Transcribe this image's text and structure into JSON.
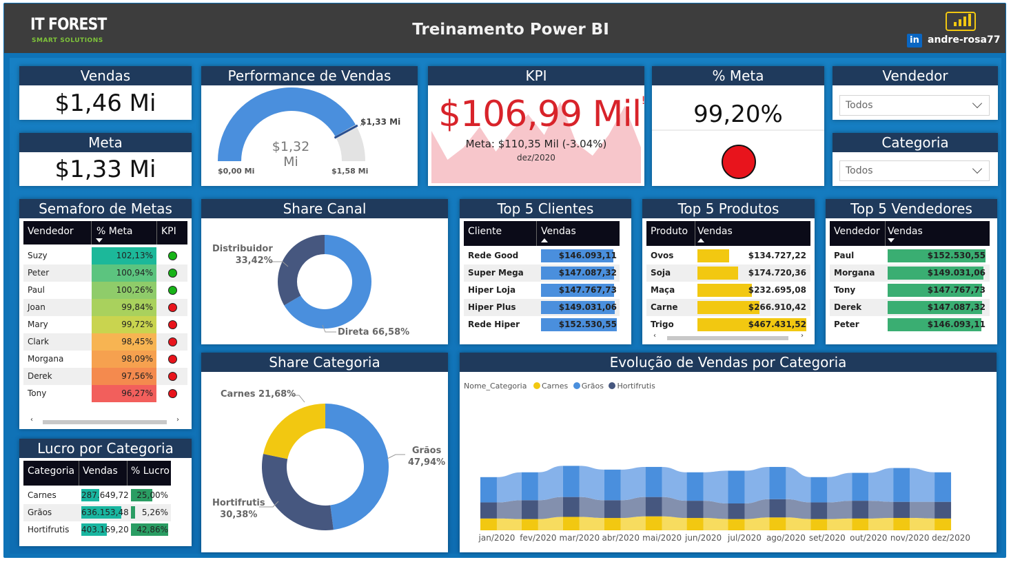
{
  "header": {
    "logo_main": "IT FOREST",
    "logo_sub": "SMART SOLUTIONS",
    "title": "Treinamento Power BI",
    "linkedin_badge": "in",
    "linkedin_user": "andre-rosa77"
  },
  "colors": {
    "header_bg": "#3d3d3d",
    "panel_bg": "#1077bb",
    "title_bar": "#1f3a5c",
    "blue": "#4a8fdd",
    "yellow": "#f2c811",
    "navy": "#46577f",
    "kpi_red": "#d8232a",
    "top_products_bar": "#f2c811",
    "top_sellers_bar": "#3aae72"
  },
  "vendas": {
    "title": "Vendas",
    "value": "$1,46 Mi"
  },
  "meta": {
    "title": "Meta",
    "value": "$1,33 Mi"
  },
  "performance": {
    "title": "Performance de Vendas",
    "center_value": "$1,32 Mi",
    "min_label": "$0,00 Mi",
    "max_label": "$1,58 Mi",
    "target_label": "$1,33 Mi",
    "value_fraction": 0.835,
    "target_fraction": 0.842
  },
  "kpi": {
    "title": "KPI",
    "value": "$106,99 Mil",
    "indicator": "!",
    "goal_text": "Meta: $110,35 Mil (-3.04%)",
    "period": "dez/2020",
    "trend": [
      0.55,
      0.2,
      0.35,
      0.6,
      0.3,
      0.55,
      0.75,
      0.5,
      0.9,
      0.4,
      0.25,
      0.5,
      0.85,
      0.35
    ]
  },
  "pct_meta": {
    "title": "% Meta",
    "value": "99,20%",
    "status_color": "#e8141c"
  },
  "vendedor_slicer": {
    "title": "Vendedor",
    "selected": "Todos"
  },
  "categoria_slicer": {
    "title": "Categoria",
    "selected": "Todos"
  },
  "semaforo": {
    "title": "Semaforo de Metas",
    "columns": [
      "Vendedor",
      "% Meta",
      "KPI"
    ],
    "rows": [
      {
        "name": "Suzy",
        "pct": "102,13%",
        "color": "#1cb89a",
        "kpi": "#17b317"
      },
      {
        "name": "Peter",
        "pct": "100,94%",
        "color": "#5cc47f",
        "kpi": "#17b317"
      },
      {
        "name": "Paul",
        "pct": "100,26%",
        "color": "#8fcc6a",
        "kpi": "#17b317"
      },
      {
        "name": "Joan",
        "pct": "99,84%",
        "color": "#a9d15d",
        "kpi": "#e8141c"
      },
      {
        "name": "Mary",
        "pct": "99,72%",
        "color": "#c9d44f",
        "kpi": "#e8141c"
      },
      {
        "name": "Clark",
        "pct": "98,45%",
        "color": "#f7b452",
        "kpi": "#e8141c"
      },
      {
        "name": "Morgana",
        "pct": "98,09%",
        "color": "#f6a14f",
        "kpi": "#e8141c"
      },
      {
        "name": "Derek",
        "pct": "97,56%",
        "color": "#f48a4e",
        "kpi": "#e8141c"
      },
      {
        "name": "Tony",
        "pct": "96,27%",
        "color": "#f25f5c",
        "kpi": "#e8141c"
      }
    ]
  },
  "lucro": {
    "title": "Lucro por Categoria",
    "columns": [
      "Categoria",
      "Vendas",
      "% Lucro"
    ],
    "rows": [
      {
        "cat": "Carnes",
        "vendas": "287.649,72",
        "vendas_frac": 0.45,
        "lucro": "25,00%",
        "lucro_frac": 0.58
      },
      {
        "cat": "Grãos",
        "vendas": "636.153,48",
        "vendas_frac": 1.0,
        "lucro": "5,26%",
        "lucro_frac": 0.12
      },
      {
        "cat": "Hortifrutis",
        "vendas": "403.169,20",
        "vendas_frac": 0.63,
        "lucro": "42,86%",
        "lucro_frac": 1.0
      }
    ]
  },
  "share_canal": {
    "title": "Share Canal",
    "slices": [
      {
        "label": "Distribuidor 33,42%",
        "name": "Distribuidor",
        "value": 33.42,
        "color": "#46577f"
      },
      {
        "label": "Direta 66,58%",
        "name": "Direta",
        "value": 66.58,
        "color": "#4a8fdd"
      }
    ]
  },
  "share_categoria": {
    "title": "Share Categoria",
    "slices": [
      {
        "label": "Grãos",
        "label2": "47,94%",
        "name": "Grãos",
        "value": 47.94,
        "color": "#4a8fdd"
      },
      {
        "label": "Hortifrutis",
        "label2": "30,38%",
        "name": "Hortifrutis",
        "value": 30.38,
        "color": "#46577f"
      },
      {
        "label": "Carnes 21,68%",
        "name": "Carnes",
        "value": 21.68,
        "color": "#f2c811"
      }
    ]
  },
  "top_clientes": {
    "title": "Top 5 Clientes",
    "columns": [
      "Cliente",
      "Vendas"
    ],
    "rows": [
      {
        "name": "Rede Good",
        "value": "$146.093,11",
        "frac": 0.957
      },
      {
        "name": "Super Mega",
        "value": "$147.087,32",
        "frac": 0.964
      },
      {
        "name": "Hiper Loja",
        "value": "$147.767,73",
        "frac": 0.968
      },
      {
        "name": "Hiper Plus",
        "value": "$149.031,06",
        "frac": 0.977
      },
      {
        "name": "Rede Hiper",
        "value": "$152.530,55",
        "frac": 1.0
      }
    ]
  },
  "top_produtos": {
    "title": "Top 5 Produtos",
    "columns": [
      "Produto",
      "Vendas"
    ],
    "rows": [
      {
        "name": "Ovos",
        "value": "$134.727,22",
        "frac": 0.288
      },
      {
        "name": "Soja",
        "value": "$174.720,36",
        "frac": 0.374
      },
      {
        "name": "Maça",
        "value": "$232.695,08",
        "frac": 0.498
      },
      {
        "name": "Carne",
        "value": "$266.910,42",
        "frac": 0.571
      },
      {
        "name": "Trigo",
        "value": "$467.431,52",
        "frac": 1.0
      }
    ]
  },
  "top_vendedores": {
    "title": "Top 5 Vendedores",
    "columns": [
      "Vendedor",
      "Vendas"
    ],
    "rows": [
      {
        "name": "Paul",
        "value": "$152.530,55",
        "frac": 1.0
      },
      {
        "name": "Morgana",
        "value": "$149.031,06",
        "frac": 0.977
      },
      {
        "name": "Tony",
        "value": "$147.767,73",
        "frac": 0.968
      },
      {
        "name": "Derek",
        "value": "$147.087,32",
        "frac": 0.964
      },
      {
        "name": "Peter",
        "value": "$146.093,11",
        "frac": 0.957
      }
    ]
  },
  "evolucao": {
    "title": "Evolução de Vendas por Categoria",
    "legend_title": "Nome_Categoria",
    "legend": [
      {
        "name": "Carnes",
        "color": "#f2c811"
      },
      {
        "name": "Grãos",
        "color": "#4a8fdd"
      },
      {
        "name": "Hortifrutis",
        "color": "#46577f"
      }
    ]
  },
  "chart_data": {
    "type": "area",
    "title": "Evolução de Vendas por Categoria",
    "x": [
      "jan/2020",
      "fev/2020",
      "mar/2020",
      "abr/2020",
      "mai/2020",
      "jun/2020",
      "jul/2020",
      "ago/2020",
      "set/2020",
      "out/2020",
      "nov/2020",
      "dez/2020"
    ],
    "series": [
      {
        "name": "Carnes",
        "values": [
          22,
          21,
          25,
          23,
          26,
          23,
          21,
          24,
          21,
          22,
          23,
          22
        ]
      },
      {
        "name": "Hortifrutis",
        "values": [
          30,
          35,
          37,
          33,
          36,
          32,
          29,
          34,
          31,
          33,
          30,
          31
        ]
      },
      {
        "name": "Grãos",
        "values": [
          47,
          52,
          58,
          57,
          56,
          53,
          61,
          60,
          47,
          52,
          63,
          55
        ]
      }
    ],
    "stacked": true,
    "legend": "top-left"
  }
}
